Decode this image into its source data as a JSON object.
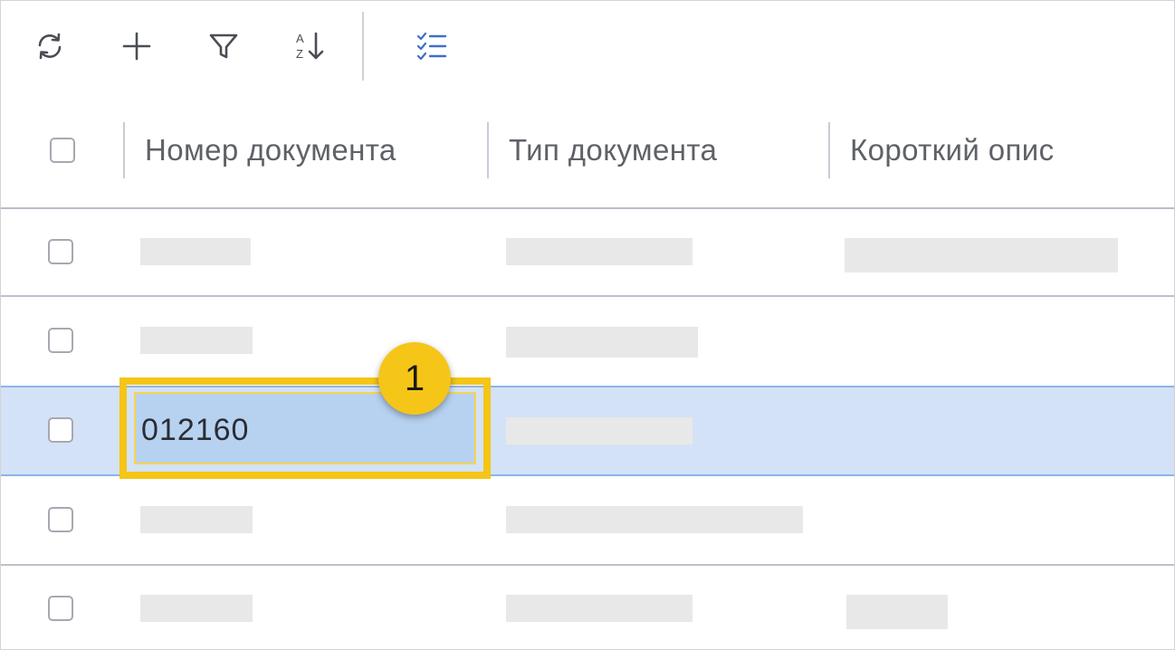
{
  "toolbar": {
    "buttons": [
      {
        "icon": "refresh-icon"
      },
      {
        "icon": "plus-icon"
      },
      {
        "icon": "filter-icon"
      },
      {
        "icon": "sort-az-icon",
        "sort_letters": [
          "A",
          "Z"
        ]
      },
      {
        "icon": "checklist-icon",
        "active": true
      }
    ]
  },
  "table": {
    "columns": [
      "Номер документа",
      "Тип документа",
      "Короткий опис"
    ],
    "selected_row_index": 2,
    "selected_cell_value": "012160"
  },
  "callout": {
    "number": "1"
  },
  "colors": {
    "accent": "#3f6fc8",
    "selected_row": "#d3e2f6",
    "selected_cell": "#b7d2f1",
    "highlight": "#f5c518",
    "placeholder": "#e8e8e8"
  }
}
